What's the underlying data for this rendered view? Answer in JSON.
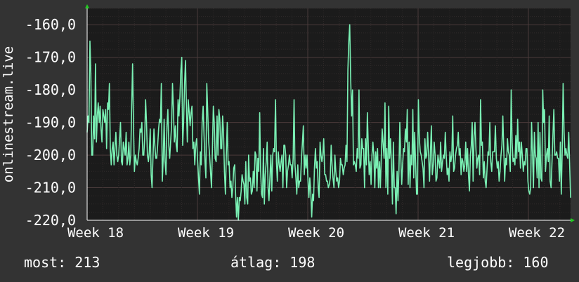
{
  "chart_data": {
    "type": "line",
    "ylabel": "onlinestream.live",
    "xlabel": "",
    "title": "",
    "ylim": [
      -220,
      -155
    ],
    "y_ticks": [
      "-160,0",
      "-170,0",
      "-180,0",
      "-190,0",
      "-200,0",
      "-210,0",
      "-220,0"
    ],
    "x_ticks": [
      "Week 18",
      "Week 19",
      "Week 20",
      "Week 21",
      "Week 22"
    ],
    "grid": true,
    "colors": {
      "background": "#333333",
      "plot": "#1b1b1b",
      "line": "#7af0b4",
      "grid_major": "#4a3b3b",
      "grid_minor": "#2f2a2a",
      "axis": "#ffffff",
      "arrow": "#22cc22"
    },
    "series": [
      {
        "values": [
          -193,
          -188,
          -190,
          -165,
          -175,
          -200,
          -200,
          -188,
          -195,
          -172,
          -196,
          -188,
          -184,
          -190,
          -185,
          -192,
          -196,
          -186,
          -188,
          -190,
          -186,
          -198,
          -184,
          -186,
          -178,
          -198,
          -203,
          -198,
          -196,
          -203,
          -198,
          -193,
          -200,
          -202,
          -200,
          -195,
          -190,
          -202,
          -203,
          -196,
          -198,
          -200,
          -193,
          -203,
          -201,
          -196,
          -203,
          -200,
          -185,
          -172,
          -191,
          -205,
          -200,
          -202,
          -203,
          -201,
          -198,
          -192,
          -193,
          -190,
          -200,
          -200,
          -195,
          -183,
          -190,
          -200,
          -202,
          -199,
          -192,
          -206,
          -210,
          -200,
          -192,
          -197,
          -201,
          -201,
          -197,
          -192,
          -189,
          -190,
          -178,
          -208,
          -201,
          -189,
          -202,
          -206,
          -191,
          -186,
          -197,
          -201,
          -196,
          -191,
          -178,
          -186,
          -196,
          -191,
          -197,
          -199,
          -183,
          -188,
          -182,
          -174,
          -170,
          -197,
          -190,
          -178,
          -171,
          -185,
          -196,
          -183,
          -187,
          -191,
          -187,
          -185,
          -198,
          -196,
          -203,
          -197,
          -195,
          -201,
          -207,
          -212,
          -199,
          -203,
          -190,
          -185,
          -194,
          -202,
          -207,
          -178,
          -187,
          -196,
          -200,
          -205,
          -210,
          -198,
          -185,
          -190,
          -201,
          -202,
          -188,
          -200,
          -186,
          -189,
          -198,
          -198,
          -188,
          -193,
          -205,
          -212,
          -200,
          -190,
          -203,
          -202,
          -210,
          -208,
          -213,
          -210,
          -204,
          -203,
          -212,
          -219,
          -213,
          -220,
          -213,
          -214,
          -211,
          -206,
          -208,
          -209,
          -215,
          -202,
          -213,
          -215,
          -200,
          -208,
          -207,
          -212,
          -211,
          -205,
          -210,
          -199,
          -200,
          -211,
          -201,
          -205,
          -187,
          -205,
          -212,
          -213,
          -198,
          -215,
          -206,
          -202,
          -196,
          -210,
          -214,
          -207,
          -200,
          -211,
          -200,
          -198,
          -199,
          -183,
          -202,
          -208,
          -199,
          -203,
          -205,
          -202,
          -200,
          -210,
          -197,
          -197,
          -200,
          -210,
          -205,
          -203,
          -200,
          -203,
          -203,
          -207,
          -201,
          -183,
          -203,
          -207,
          -212,
          -203,
          -210,
          -208,
          -208,
          -201,
          -196,
          -191,
          -206,
          -200,
          -204,
          -200,
          -208,
          -213,
          -207,
          -211,
          -219,
          -212,
          -214,
          -204,
          -198,
          -204,
          -202,
          -210,
          -213,
          -196,
          -200,
          -202,
          -200,
          -195,
          -206,
          -206,
          -208,
          -208,
          -210,
          -209,
          -207,
          -197,
          -203,
          -207,
          -210,
          -200,
          -205,
          -208,
          -207,
          -210,
          -208,
          -201,
          -203,
          -203,
          -206,
          -204,
          -203,
          -197,
          -202,
          -174,
          -165,
          -160,
          -176,
          -188,
          -180,
          -203,
          -202,
          -203,
          -205,
          -198,
          -201,
          -180,
          -204,
          -203,
          -195,
          -198,
          -198,
          -210,
          -195,
          -203,
          -187,
          -197,
          -206,
          -202,
          -209,
          -200,
          -196,
          -200,
          -210,
          -199,
          -204,
          -198,
          -210,
          -202,
          -210,
          -201,
          -192,
          -197,
          -201,
          -184,
          -210,
          -198,
          -212,
          -185,
          -201,
          -195,
          -203,
          -215,
          -196,
          -210,
          -210,
          -218,
          -205,
          -214,
          -205,
          -190,
          -200,
          -209,
          -203,
          -198,
          -199,
          -192,
          -196,
          -186,
          -209,
          -196,
          -210,
          -200,
          -203,
          -186,
          -207,
          -193,
          -203,
          -212,
          -212,
          -183,
          -195,
          -199,
          -200,
          -202,
          -204,
          -210,
          -195,
          -201,
          -200,
          -193,
          -200,
          -208,
          -199,
          -191,
          -206,
          -203,
          -196,
          -200,
          -208,
          -207,
          -200,
          -202,
          -204,
          -196,
          -205,
          -202,
          -200,
          -201,
          -193,
          -200,
          -206,
          -204,
          -208,
          -199,
          -202,
          -200,
          -188,
          -205,
          -204,
          -200,
          -198,
          -197,
          -193,
          -200,
          -198,
          -206,
          -201,
          -202,
          -205,
          -203,
          -196,
          -205,
          -198,
          -206,
          -211,
          -200,
          -197,
          -190,
          -208,
          -194,
          -190,
          -198,
          -204,
          -201,
          -200,
          -206,
          -183,
          -197,
          -196,
          -207,
          -202,
          -208,
          -210,
          -204,
          -199,
          -200,
          -190,
          -202,
          -205,
          -199,
          -199,
          -199,
          -191,
          -201,
          -204,
          -202,
          -208,
          -205,
          -200,
          -197,
          -188,
          -198,
          -208,
          -201,
          -203,
          -195,
          -199,
          -200,
          -205,
          -180,
          -196,
          -202,
          -201,
          -203,
          -194,
          -201,
          -189,
          -199,
          -196,
          -204,
          -196,
          -200,
          -205,
          -202,
          -203,
          -198,
          -198,
          -208,
          -211,
          -212,
          -210,
          -190,
          -200,
          -210,
          -193,
          -200,
          -201,
          -207,
          -190,
          -210,
          -193,
          -207,
          -208,
          -180,
          -190,
          -186,
          -205,
          -200,
          -198,
          -202,
          -188,
          -208,
          -210,
          -202,
          -194,
          -186,
          -200,
          -200,
          -199,
          -201,
          -201,
          -208,
          -196,
          -212,
          -199,
          -178,
          -193,
          -200,
          -198,
          -200,
          -201,
          -193,
          -203,
          -213
        ]
      }
    ]
  },
  "footer": {
    "current": "most: 213",
    "average": "átlag: 198",
    "best": "legjobb: 160"
  }
}
